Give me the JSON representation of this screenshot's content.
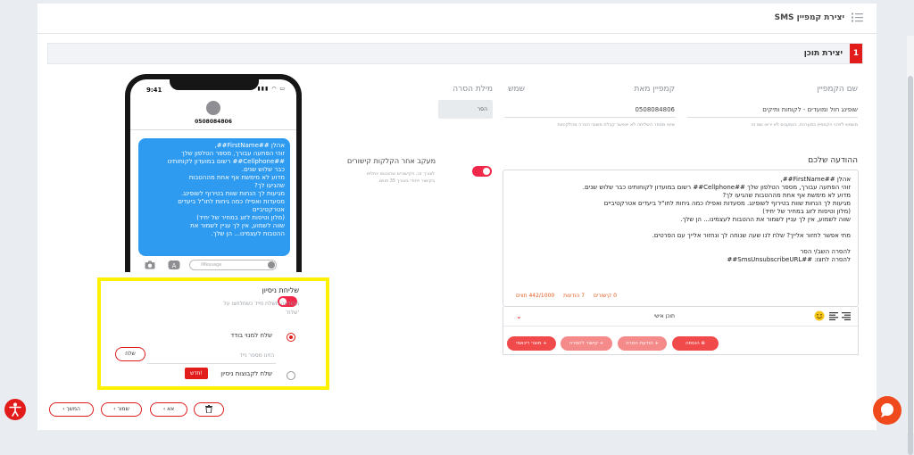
{
  "header": {
    "title": "יצירת קמפיין SMS"
  },
  "step": {
    "number": "1",
    "title": "יצירת תוכן"
  },
  "fields": {
    "campaign_name": {
      "label": "שם הקמפיין",
      "value": "שופינג חול ומועדים - לקוחות ותיקים",
      "hint": "משמש לזיהוי הקמפיין במערכת, הנמענים לא יראו שם זה"
    },
    "campaign_from": {
      "label": "קמפיין מאת",
      "value": "0508084806",
      "hint": "שינוי מספר השליחה לא יאפשר קבלת משובי הסרה מהלקוחות"
    },
    "alias": {
      "label": "שמש",
      "value": ""
    },
    "removal_word": {
      "label": "מילת הסרה",
      "value": "הסר"
    }
  },
  "tracking": {
    "label": "מעקב אחר הקלקות קישורים",
    "hint_line1": "לצורך זה, הקישורים שהוכנסו יוחלפו",
    "hint_line2": "בקישור ייחודי באורך 35 תווים."
  },
  "message": {
    "title": "ההודעה שלכם",
    "lines": [
      "אהלן ##FirstName##,",
      "זוהי הפתעה עבורך, מספר הטלפון שלך ##Cellphone## רשום במועדון לקוחותינו כבר שלוש שנים.",
      "מדוע לא מימשת אף אחת מההטבות שהגיעו לך?",
      "מגיעות לך הנחות שוות בטירוף לשופינג. מסעדות ואפילו כמה גיחות לחו\"ל ביעדים אטרקטיביים",
      "(מלון וטיסות לזוג במחיר של יחיד)",
      "שווה לשמוע, אין לך עניין לשמור את ההטבות לעצמינו... הן שלך.",
      "",
      "מתי אפשר לחזור אלייך? שלח לנו שעה שנוחה לך ונחזור אלייך עם הפרטים.",
      "",
      "להסרה השב/י הסר",
      "להסרה לחצו: ##SmsUnsubscribeURL##"
    ],
    "chars": "442/1000 תווים",
    "messages": "7 הודעות",
    "clicks": "0 קישורים"
  },
  "toolbar": {
    "personal_content": "תוכן אישי",
    "buttons": {
      "add": "הוספה",
      "removal_msg": "+ הודעת הסרה",
      "removal_link": "+ קישור להסרה",
      "dynamic_product": "+ מוצר דינאמי"
    }
  },
  "phone": {
    "time": "9:41",
    "status": "▮▮▮ ◠ ▭",
    "number": "0508084806",
    "bubble_lines": [
      "אהלן ##FirstName##,",
      "זוהי הפתעה עבורך, מספר הטלפון שלך",
      "##Cellphone## רשום במועדון לקוחותינו",
      "כבר שלוש שנים.",
      "מדוע לא מימשת אף אחת מההטבות",
      "שהגיעו לך?",
      "מגיעות לך הנחות שוות בטירוף לשופינג.",
      "מסעדות ואפילו כמה גיחות לחו\"ל ביעדים",
      "אטרקטיביים",
      "(מלון וטיסות לזוג במחיר של יחיד)",
      "שווה לשמוע, אין לך עניין לשמור את",
      "ההטבות לעצמינו... הן שלך."
    ],
    "input_placeholder": "iMessage"
  },
  "test_send": {
    "title": "שליחת ניסיון",
    "subtitle_line1": "ההודעה תשלח מייד כשתלחצו על",
    "subtitle_line2": "'שלח'",
    "single_label": "שלח למנוי בודד",
    "phone_placeholder": "הזינו מספר נייד",
    "send_button": "שלח",
    "group_label": "שלח לקבוצות ניסיון",
    "new_badge": "חדש!"
  },
  "footer": {
    "next": "המשך",
    "save": "שמור",
    "back": "אא"
  },
  "colors": {
    "accent": "#e21b1b",
    "bubble": "#2e9bf0",
    "highlight": "#fff200",
    "toggle": "#f0284a"
  }
}
